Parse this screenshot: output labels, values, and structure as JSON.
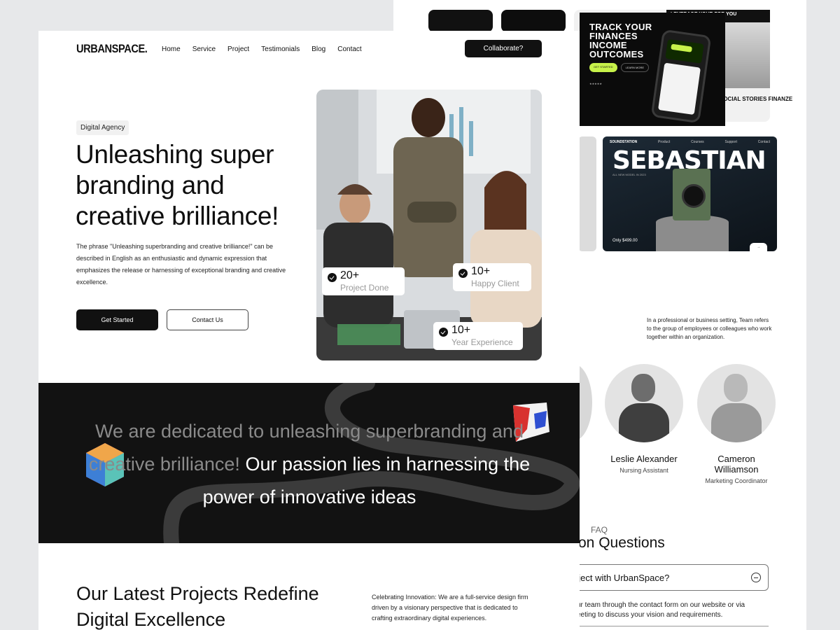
{
  "background_page": {
    "finance": {
      "headline": "TRACK YOUR FINANCES INCOME OUTCOMES",
      "primary_button": "GET STARTED",
      "secondary_button": "LEARN MORE",
      "top_strip": "LEVERAGE YOUR FOR YOU",
      "social_label": "SOCIAL STORIES FINANZE",
      "balance": "$410,862.18"
    },
    "sound": {
      "brand": "SOUNDSTATION",
      "nav": [
        "Product",
        "Courses",
        "Support",
        "Contact"
      ],
      "title": "SEBASTIAN",
      "subtitle": "ALL NEW MODEL IN 2023",
      "price": "Only $499.00"
    },
    "team": {
      "intro": "In a professional or business setting, Team refers to the group of employees or colleagues who work together within an organization.",
      "members": [
        {
          "name": "Leslie Alexander",
          "role": "Nursing Assistant"
        },
        {
          "name": "Cameron Williamson",
          "role": "Marketing Coordinator"
        }
      ]
    },
    "faq": {
      "tag": "FAQ",
      "title": "on Questions",
      "question": "oject with UrbanSpace?",
      "answer": "ur team through the contact form on our website or via eeting to discuss your vision and requirements."
    }
  },
  "main_page": {
    "logo": "URBANSPACE.",
    "nav": {
      "home": "Home",
      "service": "Service",
      "project": "Project",
      "testimonials": "Testimonials",
      "blog": "Blog",
      "contact": "Contact"
    },
    "collaborate_button": "Collaborate?",
    "hero": {
      "tag": "Digital Agency",
      "title": "Unleashing super branding and creative brilliance!",
      "description": "The phrase \"Unleashing superbranding and creative brilliance!\" can be described in English as an enthusiastic and dynamic expression that emphasizes the release or harnessing of exceptional branding and creative excellence.",
      "primary_button": "Get Started",
      "secondary_button": "Contact Us"
    },
    "stats": [
      {
        "value": "20+",
        "label": "Project Done"
      },
      {
        "value": "10+",
        "label": "Happy Client"
      },
      {
        "value": "10+",
        "label": "Year Experience"
      }
    ],
    "mission": {
      "dim_text": "We are dedicated to unleashing superbranding and creative brilliance!",
      "bright_text": "Our passion lies in harnessing the power of innovative ideas"
    },
    "projects": {
      "title": "Our Latest Projects Redefine Digital Excellence",
      "description": "Celebrating Innovation: We are a full-service design firm driven by a visionary perspective that is dedicated to crafting extraordinary digital experiences."
    }
  },
  "colors": {
    "page_background": "#e7e8ea",
    "dark": "#111111",
    "accent_lime": "#c7f24a",
    "muted_text": "#8a8a8a"
  }
}
